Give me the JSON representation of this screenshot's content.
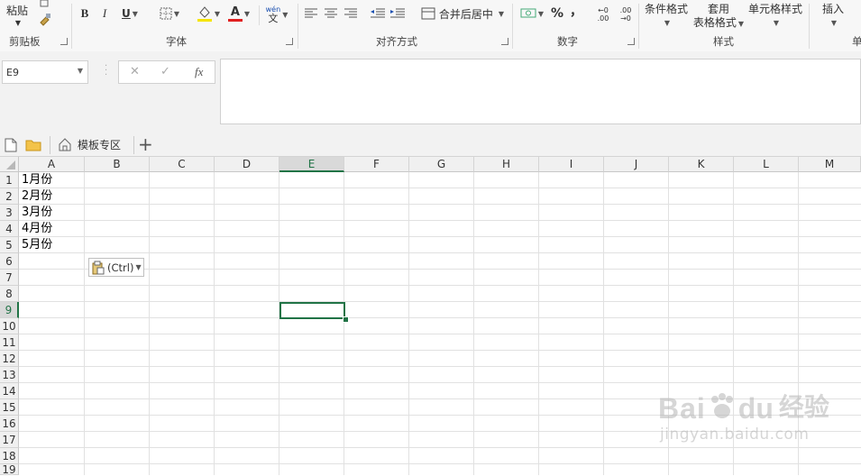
{
  "ribbon": {
    "clipboard": {
      "paste": "粘贴",
      "label": "剪贴板"
    },
    "font": {
      "bold": "B",
      "italic": "I",
      "underline": "U",
      "font_color_glyph": "A",
      "label": "字体"
    },
    "alignment": {
      "merge_center": "合并后居中",
      "label": "对齐方式",
      "pinyin_top": "wén",
      "pinyin_bottom": "文"
    },
    "number": {
      "percent": "%",
      "comma": "，",
      "inc_decimal": "←0 .00",
      "dec_decimal": ".00 →0",
      "label": "数字"
    },
    "styles": {
      "conditional": "条件格式",
      "table_fmt_top": "套用",
      "table_fmt_bottom": "表格格式",
      "cell_style": "单元格样式",
      "label": "样式"
    },
    "insert": {
      "label": "插入",
      "cut_label": "单"
    }
  },
  "formula_bar": {
    "name_box": "E9",
    "cancel": "✕",
    "confirm": "✓",
    "fx": "fx",
    "value": ""
  },
  "tabs": {
    "template_zone": "模板专区",
    "add": "+"
  },
  "sheet": {
    "columns": [
      "A",
      "B",
      "C",
      "D",
      "E",
      "F",
      "G",
      "H",
      "I",
      "J",
      "K",
      "L",
      "M"
    ],
    "rows": [
      "1",
      "2",
      "3",
      "4",
      "5",
      "6",
      "7",
      "8",
      "9",
      "10",
      "11",
      "12",
      "13",
      "14",
      "15",
      "16",
      "17",
      "18",
      "19"
    ],
    "cells_a": [
      "1月份",
      "2月份",
      "3月份",
      "4月份",
      "5月份"
    ],
    "active_cell": "E9",
    "paste_option": "(Ctrl)"
  },
  "colors": {
    "accent": "#217346",
    "active_header": "#217346"
  },
  "watermark": {
    "brand": "Bai",
    "brand2": "du",
    "product": "经验",
    "url": "jingyan.baidu.com"
  }
}
